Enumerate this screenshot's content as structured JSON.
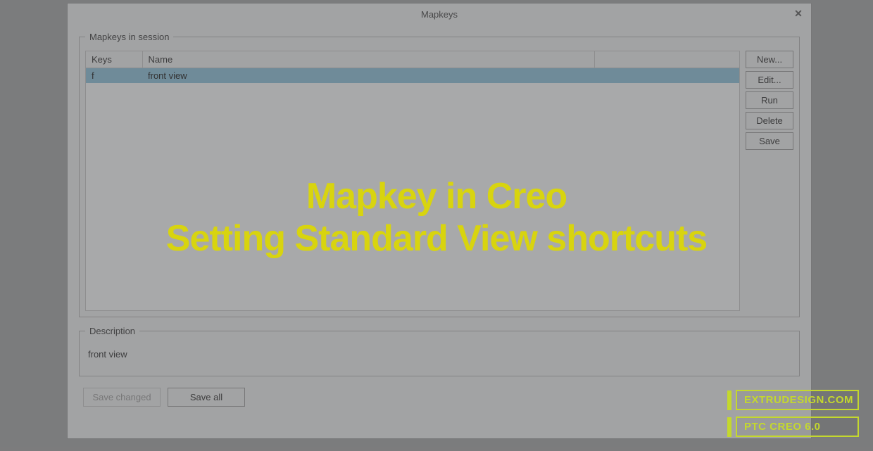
{
  "dialog": {
    "title": "Mapkeys",
    "close_symbol": "✕"
  },
  "session": {
    "legend": "Mapkeys in session",
    "columns": {
      "keys": "Keys",
      "name": "Name"
    },
    "rows": [
      {
        "key": "f",
        "name": "front view"
      }
    ],
    "buttons": {
      "new": "New...",
      "edit": "Edit...",
      "run": "Run",
      "delete": "Delete",
      "save": "Save"
    }
  },
  "description": {
    "legend": "Description",
    "text": "front view"
  },
  "bottom": {
    "save_changed": "Save changed",
    "save_all": "Save all"
  },
  "overlay": {
    "line1": "Mapkey in Creo",
    "line2": "Setting Standard View shortcuts"
  },
  "watermark": {
    "site": "EXTRUDESIGN.COM",
    "product": "PTC CREO 6.0"
  }
}
